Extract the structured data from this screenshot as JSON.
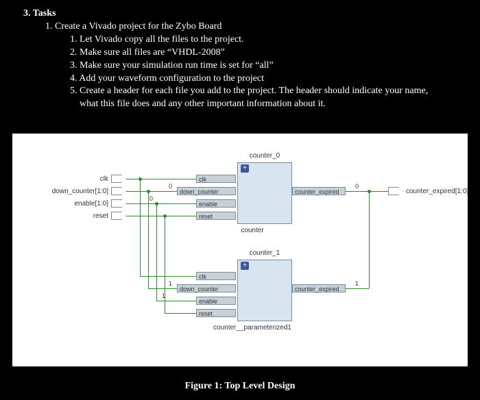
{
  "tasks": {
    "heading": "3. Tasks",
    "main_item": "1. Create a Vivado project for the Zybo Board",
    "sub_items": [
      "1. Let Vivado copy all the files to the project.",
      "2. Make sure all files are “VHDL-2008”",
      "3. Make sure your simulation run time is set for “all”",
      "4. Add your waveform configuration to the project",
      "5. Create a header for each file you add to the project.  The header should indicate your name,",
      "what this file does and any other important information about it."
    ]
  },
  "diagram": {
    "caption": "Figure 1: Top Level Design",
    "external_inputs": [
      {
        "name": "clk",
        "label": "clk"
      },
      {
        "name": "down_counter_bus",
        "label": "down_counter[1:0]"
      },
      {
        "name": "enable_bus",
        "label": "enable[1:0]"
      },
      {
        "name": "reset",
        "label": "reset"
      }
    ],
    "external_outputs": [
      {
        "name": "counter_expired_bus",
        "label": "counter_expired[1:0]"
      }
    ],
    "blocks": [
      {
        "id": "counter_0",
        "header": "counter_0",
        "inputs": [
          "clk",
          "down_counter",
          "enable",
          "reset"
        ],
        "outputs": [
          "counter_expired"
        ],
        "instance": "counter"
      },
      {
        "id": "counter_1",
        "header": "counter_1",
        "inputs": [
          "clk",
          "down_counter",
          "enable",
          "reset"
        ],
        "outputs": [
          "counter_expired"
        ],
        "instance": "counter__parameterized1"
      }
    ],
    "bus_indices": {
      "b0_dc": "0",
      "b0_en": "0",
      "b0_ce": "0",
      "b1_dc": "1",
      "b1_en": "1",
      "b1_ce": "1"
    }
  }
}
